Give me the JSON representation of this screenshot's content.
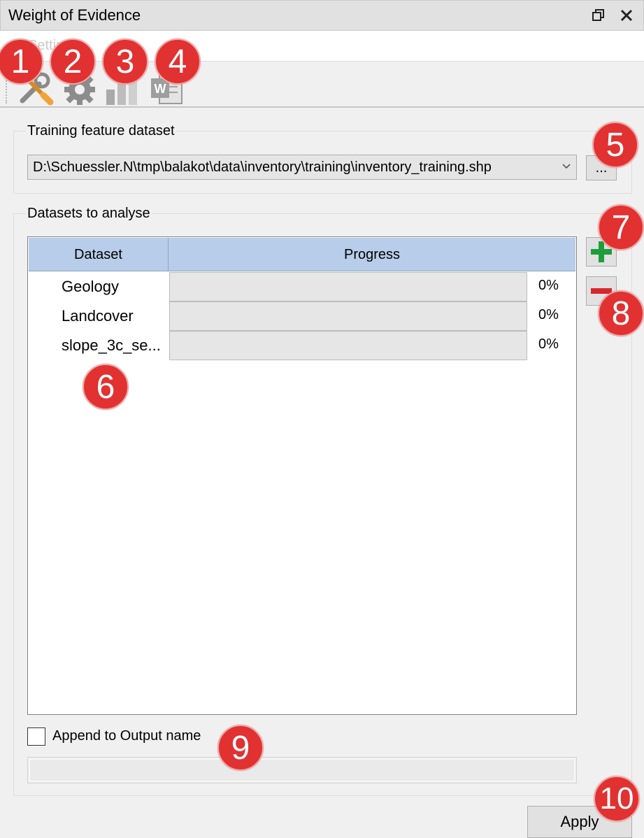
{
  "window": {
    "title": "Weight of Evidence"
  },
  "tabstrip": {
    "faded_text": "Settin"
  },
  "toolbar": {
    "tools": [
      {
        "icon": "settings-tools-icon",
        "badge": "1"
      },
      {
        "icon": "gear-icon",
        "badge": "2"
      },
      {
        "icon": "bar-chart-icon",
        "badge": "3"
      },
      {
        "icon": "word-document-icon",
        "badge": "4"
      }
    ]
  },
  "training": {
    "group_label": "Training feature dataset",
    "selected_path": "D:\\Schuessler.N\\tmp\\balakot\\data\\inventory\\training\\inventory_training.shp",
    "browse_label": "...",
    "badge": "5"
  },
  "analyse": {
    "group_label": "Datasets to analyse",
    "columns": [
      "Dataset",
      "Progress"
    ],
    "rows": [
      {
        "name": "Geology",
        "progress": 0,
        "progress_text": "0%"
      },
      {
        "name": "Landcover",
        "progress": 0,
        "progress_text": "0%"
      },
      {
        "name": "slope_3c_se...",
        "progress": 0,
        "progress_text": "0%"
      }
    ],
    "table_badge": "6",
    "add_badge": "7",
    "remove_badge": "8"
  },
  "output": {
    "append_label": "Append to Output name",
    "append_checked": false,
    "name_value": "",
    "badge": "9"
  },
  "footer": {
    "apply_label": "Apply",
    "badge": "10"
  },
  "colors": {
    "badge": "#e13131",
    "header": "#b8cde9",
    "add": "#1e9e3a",
    "remove": "#d8262f"
  }
}
